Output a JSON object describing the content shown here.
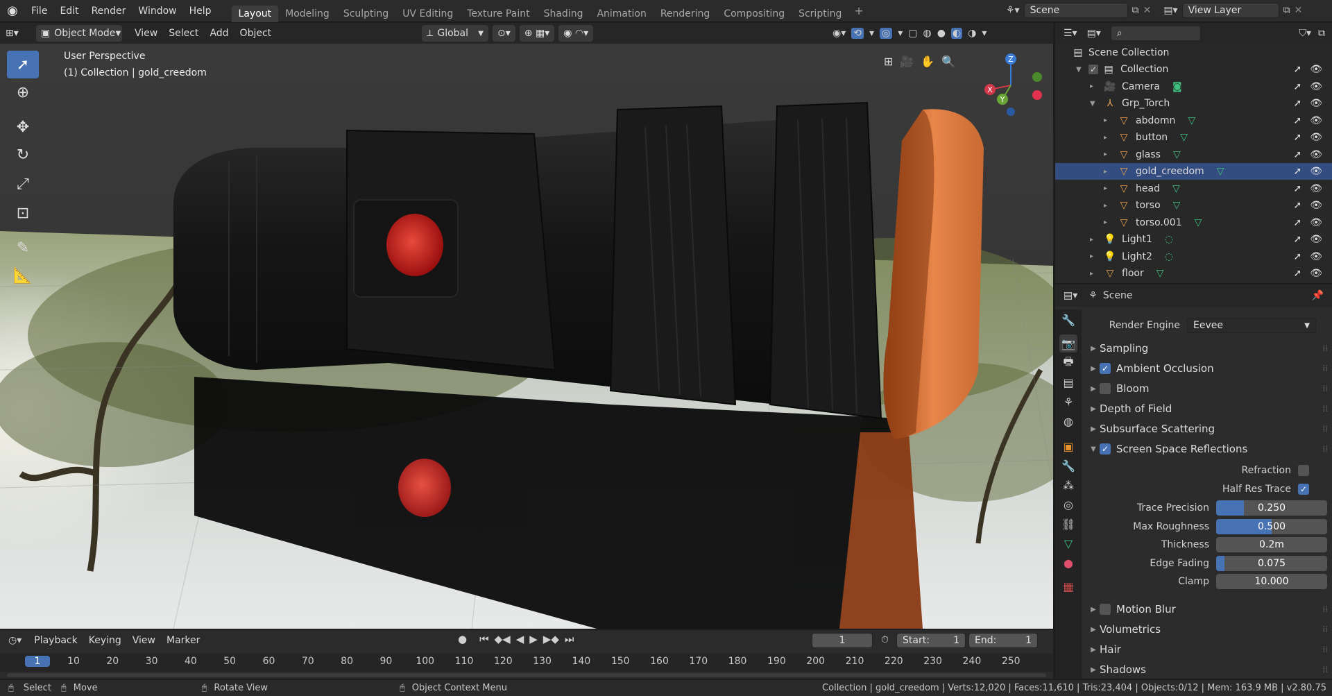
{
  "menus": [
    "File",
    "Edit",
    "Render",
    "Window",
    "Help"
  ],
  "workspaces": [
    "Layout",
    "Modeling",
    "Sculpting",
    "UV Editing",
    "Texture Paint",
    "Shading",
    "Animation",
    "Rendering",
    "Compositing",
    "Scripting"
  ],
  "active_workspace": "Layout",
  "scene_name": "Scene",
  "view_layer": "View Layer",
  "viewport_header": {
    "mode": "Object Mode",
    "menus": [
      "View",
      "Select",
      "Add",
      "Object"
    ],
    "transform_orientation": "Global"
  },
  "viewport": {
    "perspective_label": "User Perspective",
    "collection_label": "(1) Collection | gold_creedom",
    "gizmo_axes": {
      "z": "Z",
      "x": "X",
      "y": "Y"
    }
  },
  "outliner": {
    "root": "Scene Collection",
    "items": [
      {
        "name": "Collection",
        "icon": "collection-icon",
        "indent": 1,
        "expand": "▼"
      },
      {
        "name": "Camera",
        "icon": "camera-icon",
        "indent": 2,
        "expand": "▸"
      },
      {
        "name": "Grp_Torch",
        "icon": "empty-icon",
        "indent": 2,
        "expand": "▼"
      },
      {
        "name": "abdomn",
        "icon": "mesh-icon",
        "indent": 3,
        "expand": "▸"
      },
      {
        "name": "button",
        "icon": "mesh-icon",
        "indent": 3,
        "expand": "▸"
      },
      {
        "name": "glass",
        "icon": "mesh-icon",
        "indent": 3,
        "expand": "▸"
      },
      {
        "name": "gold_creedom",
        "icon": "mesh-icon",
        "indent": 3,
        "expand": "▸"
      },
      {
        "name": "head",
        "icon": "mesh-icon",
        "indent": 3,
        "expand": "▸"
      },
      {
        "name": "torso",
        "icon": "mesh-icon",
        "indent": 3,
        "expand": "▸"
      },
      {
        "name": "torso.001",
        "icon": "mesh-icon",
        "indent": 3,
        "expand": "▸"
      },
      {
        "name": "Light1",
        "icon": "light-icon",
        "indent": 2,
        "expand": "▸"
      },
      {
        "name": "Light2",
        "icon": "light-icon",
        "indent": 2,
        "expand": "▸"
      },
      {
        "name": "floor",
        "icon": "mesh-icon",
        "indent": 2,
        "expand": "▸"
      }
    ]
  },
  "properties": {
    "header_title": "Scene",
    "render_engine_label": "Render Engine",
    "render_engine": "Eevee",
    "panels": [
      {
        "label": "Sampling",
        "checkbox": null,
        "open": false
      },
      {
        "label": "Ambient Occlusion",
        "checkbox": true,
        "open": false
      },
      {
        "label": "Bloom",
        "checkbox": false,
        "open": false
      },
      {
        "label": "Depth of Field",
        "checkbox": null,
        "open": false
      },
      {
        "label": "Subsurface Scattering",
        "checkbox": null,
        "open": false
      },
      {
        "label": "Screen Space Reflections",
        "checkbox": true,
        "open": true
      }
    ],
    "ssr": {
      "refraction_label": "Refraction",
      "refraction": false,
      "half_res_label": "Half Res Trace",
      "half_res": true,
      "fields": [
        {
          "label": "Trace Precision",
          "value": "0.250",
          "fill": 0.25
        },
        {
          "label": "Max Roughness",
          "value": "0.500",
          "fill": 0.5
        },
        {
          "label": "Thickness",
          "value": "0.2m",
          "fill": 0.0
        },
        {
          "label": "Edge Fading",
          "value": "0.075",
          "fill": 0.075
        },
        {
          "label": "Clamp",
          "value": "10.000",
          "fill": 0.0
        }
      ]
    },
    "panels_after": [
      {
        "label": "Motion Blur",
        "checkbox": false
      },
      {
        "label": "Volumetrics",
        "checkbox": null
      },
      {
        "label": "Hair",
        "checkbox": null
      },
      {
        "label": "Shadows",
        "checkbox": null
      }
    ]
  },
  "timeline": {
    "menus": [
      "Playback",
      "Keying",
      "View",
      "Marker"
    ],
    "current_frame": "1",
    "start_label": "Start:",
    "start": "1",
    "end_label": "End:",
    "end": "1",
    "ruler": [
      "1",
      "10",
      "20",
      "30",
      "40",
      "50",
      "60",
      "70",
      "80",
      "90",
      "100",
      "110",
      "120",
      "130",
      "140",
      "150",
      "160",
      "170",
      "180",
      "190",
      "200",
      "210",
      "220",
      "230",
      "240",
      "250"
    ]
  },
  "statusbar": {
    "select": "Select",
    "move": "Move",
    "rotate": "Rotate View",
    "context": "Object Context Menu",
    "stats": "Collection | gold_creedom | Verts:12,020 | Faces:11,610 | Tris:23,404 | Objects:0/12 | Mem: 163.9 MB | v2.80.75"
  },
  "colors": {
    "accent": "#4772b3",
    "selected_row": "#334d80",
    "orange": "#d97a3a",
    "mesh_icon": "#e8a050",
    "data_icon": "#3fbf7f"
  }
}
